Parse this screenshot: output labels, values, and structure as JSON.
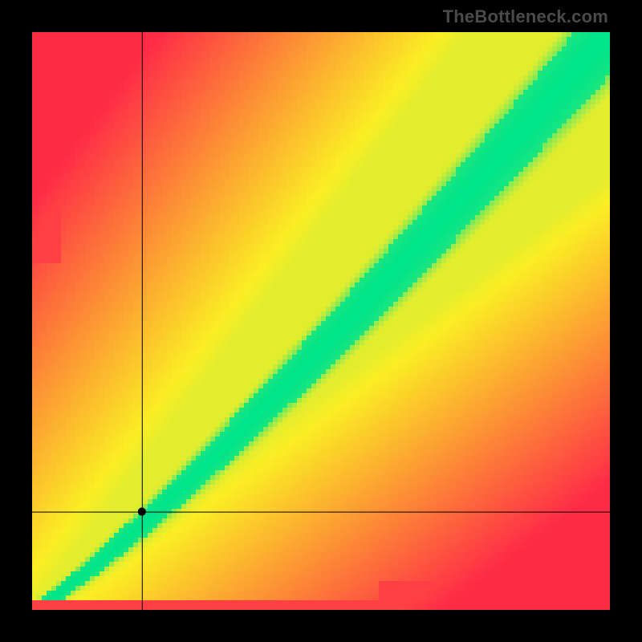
{
  "watermark": "TheBottleneck.com",
  "chart_data": {
    "type": "heatmap",
    "title": "",
    "xlabel": "",
    "ylabel": "",
    "xlim": [
      0,
      100
    ],
    "ylim": [
      0,
      100
    ],
    "grid": false,
    "legend": false,
    "colorscale": [
      {
        "value": 0.0,
        "color": "#fe2b47"
      },
      {
        "value": 0.5,
        "color": "#fbee24"
      },
      {
        "value": 1.0,
        "color": "#00e48a"
      }
    ],
    "optimal_band": {
      "description": "Green diagonal ridge where CPU and GPU are balanced; yellow transition; red far from balance.",
      "approx_slope": 1.0,
      "curves_toward_origin": true
    },
    "crosshair": {
      "x": 19,
      "y": 17
    },
    "marker": {
      "x": 19,
      "y": 17,
      "radius": 5,
      "color": "#000000"
    }
  }
}
